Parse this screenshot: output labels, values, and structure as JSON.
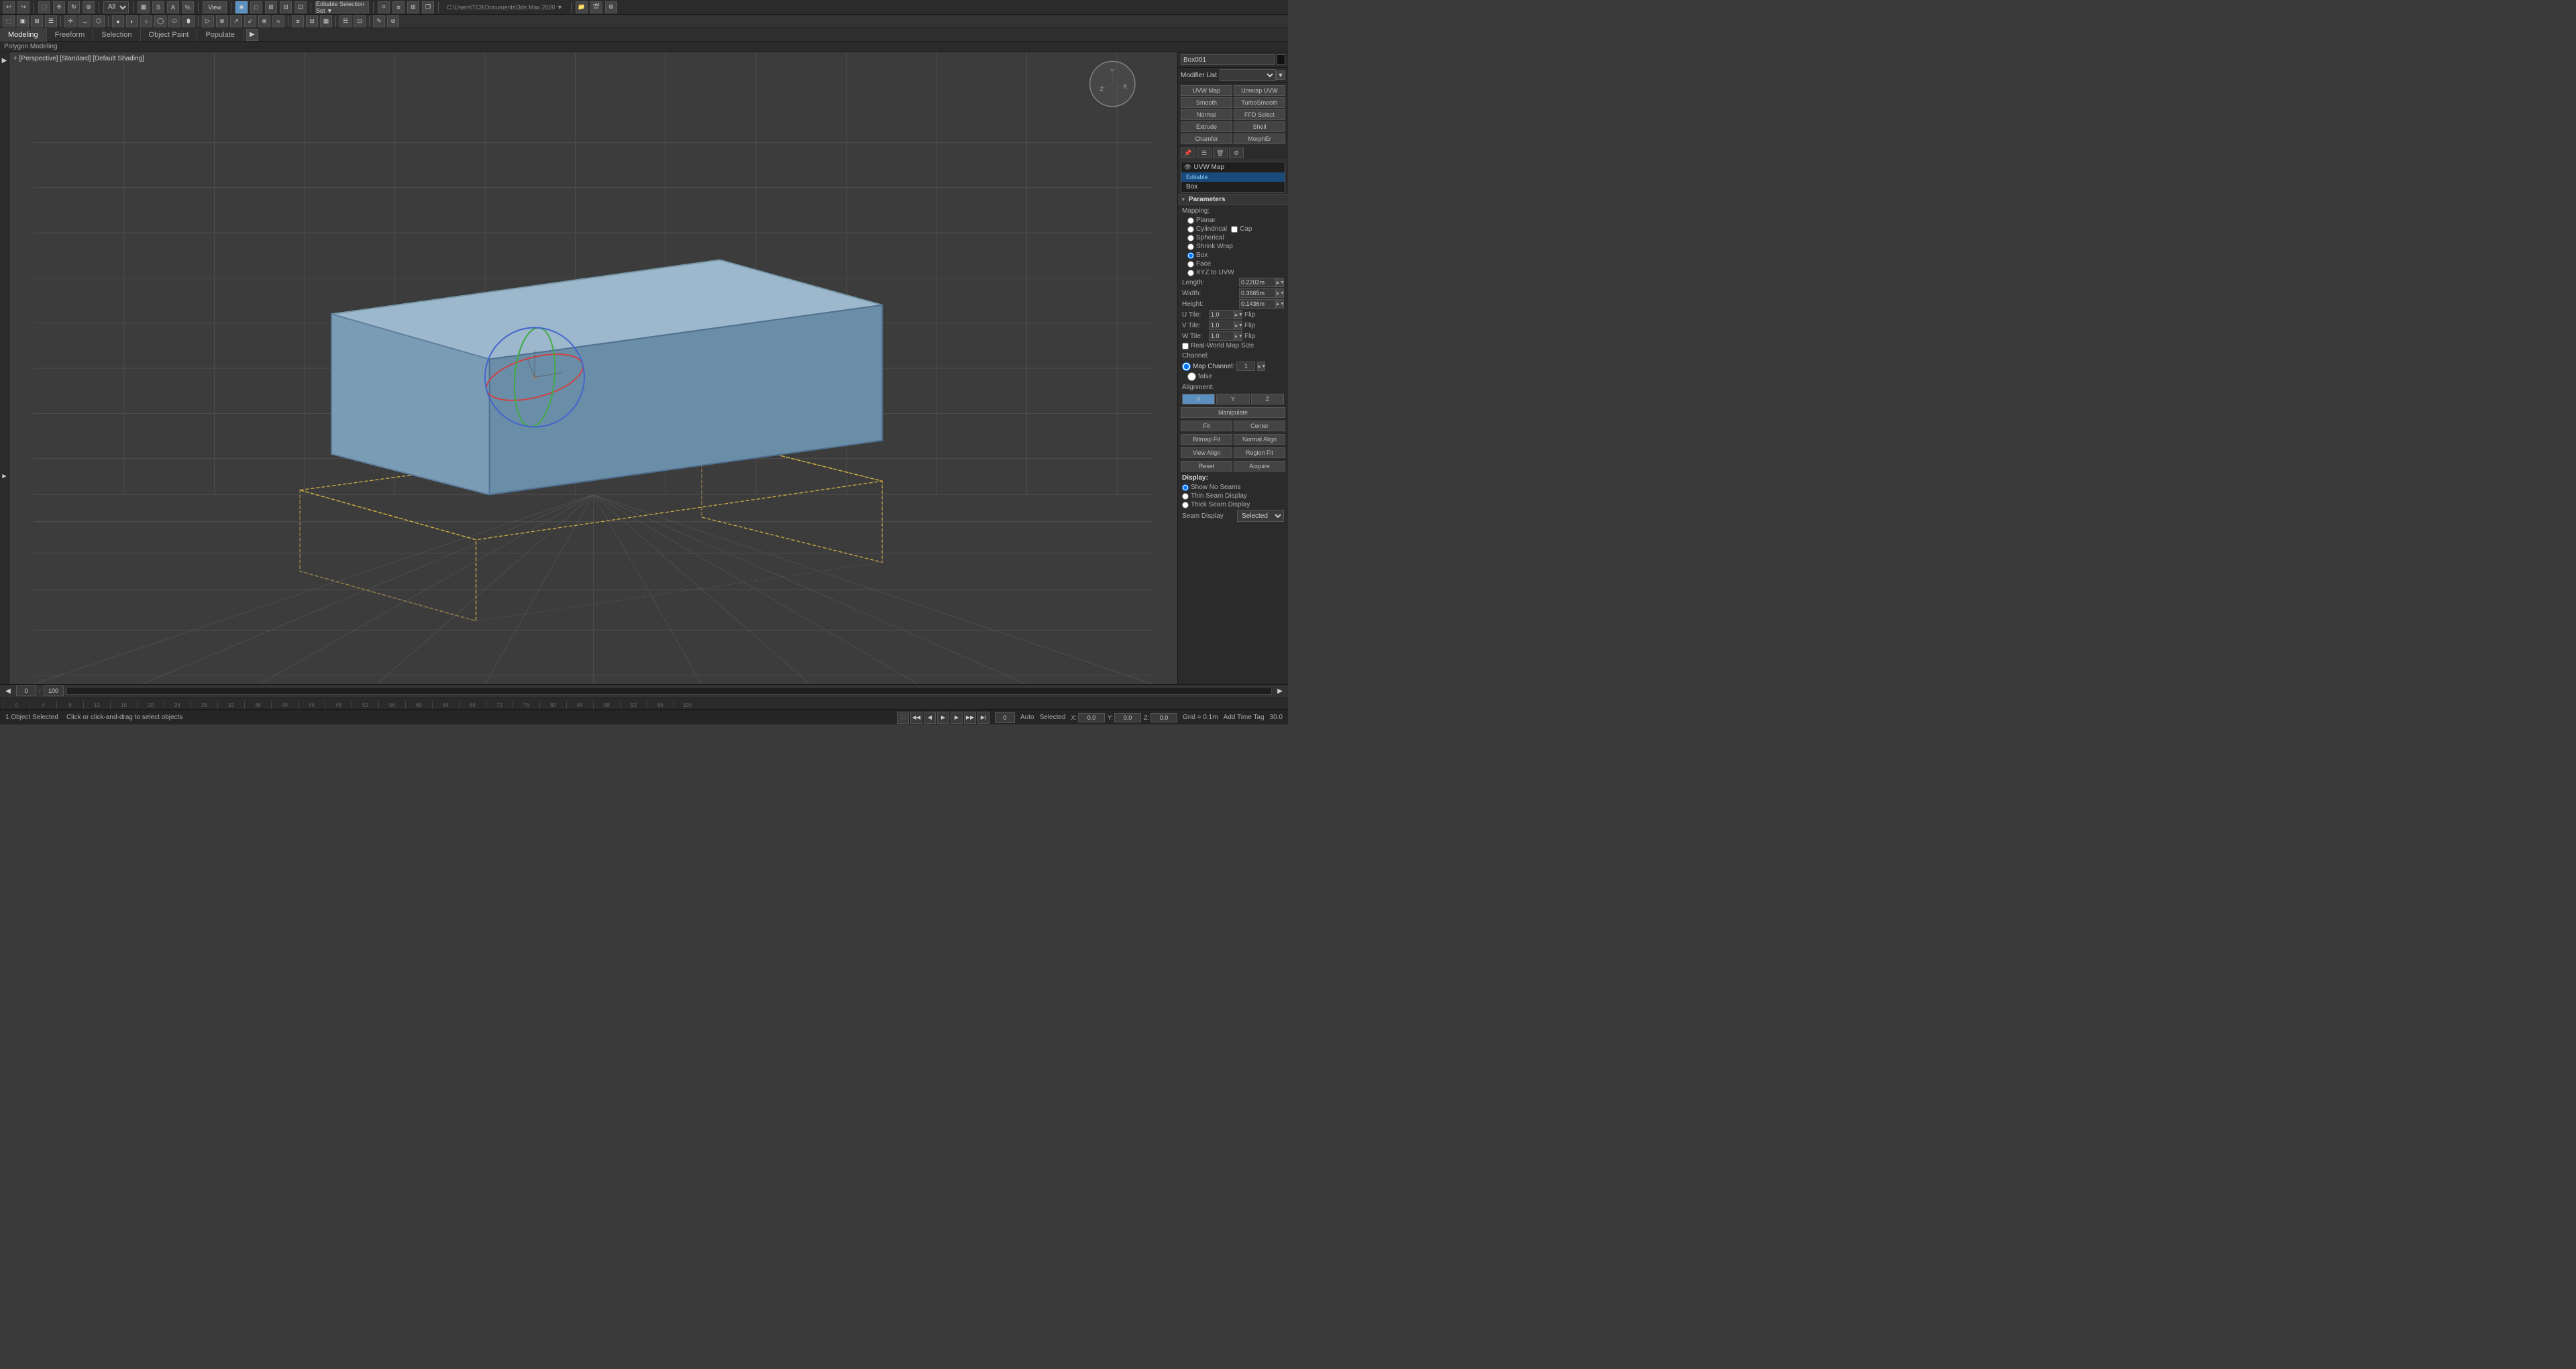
{
  "app": {
    "title": "3ds Max 2020",
    "object_name": "Box001"
  },
  "top_toolbar": {
    "mode_dropdown": "All",
    "view_label": "View",
    "path": "C:\\Users\\TC9\\Documents\\3ds Max 2020 ▼"
  },
  "tabs": [
    {
      "label": "Modeling",
      "active": true
    },
    {
      "label": "Freeform",
      "active": false
    },
    {
      "label": "Selection",
      "active": false
    },
    {
      "label": "Object Paint",
      "active": false
    },
    {
      "label": "Populate",
      "active": false
    }
  ],
  "subtitle": "Polygon Modeling",
  "viewport": {
    "label": "+ [Perspective] [Standard] [Default Shading]",
    "background_color": "#4a5a6a"
  },
  "right_panel": {
    "object_name": "Box001",
    "modifier_list_label": "Modifier List",
    "modifiers": [
      {
        "label": "UVW Map",
        "col": 0
      },
      {
        "label": "Unwrap UVW",
        "col": 1
      },
      {
        "label": "Smooth",
        "col": 0
      },
      {
        "label": "TurboSmooth",
        "col": 1
      },
      {
        "label": "Normal",
        "col": 0
      },
      {
        "label": "FFD Select",
        "col": 1
      },
      {
        "label": "Extrude",
        "col": 0
      },
      {
        "label": "Shell",
        "col": 1
      },
      {
        "label": "Chamfer",
        "col": 0
      },
      {
        "label": "MorphEr",
        "col": 1
      }
    ],
    "stack": [
      {
        "label": "UVW Map",
        "active": true,
        "eye": true
      },
      {
        "label": "Editable",
        "active": false,
        "eye": false
      },
      {
        "label": "Box",
        "active": false,
        "eye": false
      }
    ],
    "stack_icons": [
      "pin",
      "list",
      "delete",
      "settings"
    ],
    "parameters_section": {
      "label": "Parameters",
      "mapping_label": "Mapping:",
      "mapping_options": [
        {
          "label": "Planar",
          "selected": false
        },
        {
          "label": "Cylindrical",
          "selected": false
        },
        {
          "label": "Cap",
          "selected": false
        },
        {
          "label": "Spherical",
          "selected": false
        },
        {
          "label": "Shrink Wrap",
          "selected": false
        },
        {
          "label": "Box",
          "selected": true
        },
        {
          "label": "Face",
          "selected": false
        },
        {
          "label": "XYZ to UVW",
          "selected": false
        }
      ],
      "length_label": "Length:",
      "length_value": "0.2202m",
      "width_label": "Width:",
      "width_value": "0.3665m",
      "height_label": "Height:",
      "height_value": "0.1436m",
      "u_tile_label": "U Tile:",
      "u_tile_value": "1.0",
      "u_flip": false,
      "v_tile_label": "V Tile:",
      "v_tile_value": "1.0",
      "v_flip": false,
      "w_tile_label": "W Tile:",
      "w_tile_value": "1.0",
      "w_flip": false,
      "real_world_map_size": false,
      "channel_label": "Channel:",
      "map_channel_label": "Map Channel:",
      "map_channel_value": "1",
      "vertex_color_channel": false,
      "alignment_label": "Alignment:",
      "align_x": true,
      "align_y": false,
      "align_z": false,
      "manipulate_btn": "Manipulate",
      "fit_btn": "Fit",
      "center_btn": "Center",
      "bitmap_fit_btn": "Bitmap Fit",
      "normal_align_btn": "Normal Align",
      "view_align_btn": "View Align",
      "region_fit_btn": "Region Fit",
      "reset_btn": "Reset",
      "acquire_btn": "Acquire"
    },
    "display_section": {
      "label": "Display:",
      "show_no_seams": "Show No Seams",
      "thin_seam_display": "Thin Seam Display",
      "thick_seam_display": "Thick Seam Display",
      "seam_display_label": "Seam Display",
      "selected_option": "Selected"
    }
  },
  "timeline": {
    "frame_current": "0",
    "frame_total": "100",
    "numbers": [
      "0",
      "4",
      "8",
      "12",
      "16",
      "20",
      "24",
      "28",
      "32",
      "36",
      "40",
      "44",
      "48",
      "52",
      "56",
      "60",
      "64",
      "68",
      "72",
      "76",
      "80",
      "84",
      "88",
      "92",
      "96",
      "100"
    ]
  },
  "status_bar": {
    "left_text": "1 Object Selected",
    "hint_text": "Click or click-and-drag to select objects",
    "x": "0.0",
    "y": "0.0",
    "z": "0.0",
    "grid": "Grid = 0.1m",
    "auto_label": "Auto",
    "selected_label": "Selected",
    "time_tag": "Add Time Tag",
    "frame_rate": "30.0"
  }
}
